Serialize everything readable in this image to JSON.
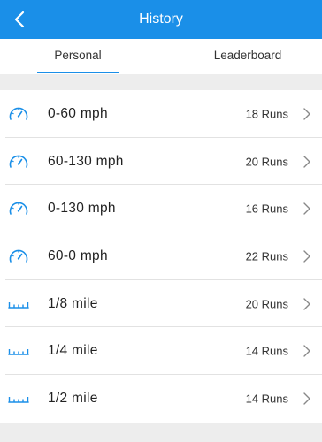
{
  "header": {
    "title": "History",
    "back_icon": "chevron-left-icon",
    "color": "#1a8fe8"
  },
  "tabs": [
    {
      "label": "Personal",
      "active": true
    },
    {
      "label": "Leaderboard",
      "active": false
    }
  ],
  "list": [
    {
      "icon": "speedometer-icon",
      "name": "0-60 mph",
      "runs": "18 Runs"
    },
    {
      "icon": "speedometer-icon",
      "name": "60-130 mph",
      "runs": "20 Runs"
    },
    {
      "icon": "speedometer-icon",
      "name": "0-130 mph",
      "runs": "16 Runs"
    },
    {
      "icon": "speedometer-icon",
      "name": "60-0 mph",
      "runs": "22 Runs"
    },
    {
      "icon": "ruler-icon",
      "name": "1/8 mile",
      "runs": "20 Runs"
    },
    {
      "icon": "ruler-icon",
      "name": "1/4 mile",
      "runs": "14 Runs"
    },
    {
      "icon": "ruler-icon",
      "name": "1/2 mile",
      "runs": "14 Runs"
    }
  ]
}
